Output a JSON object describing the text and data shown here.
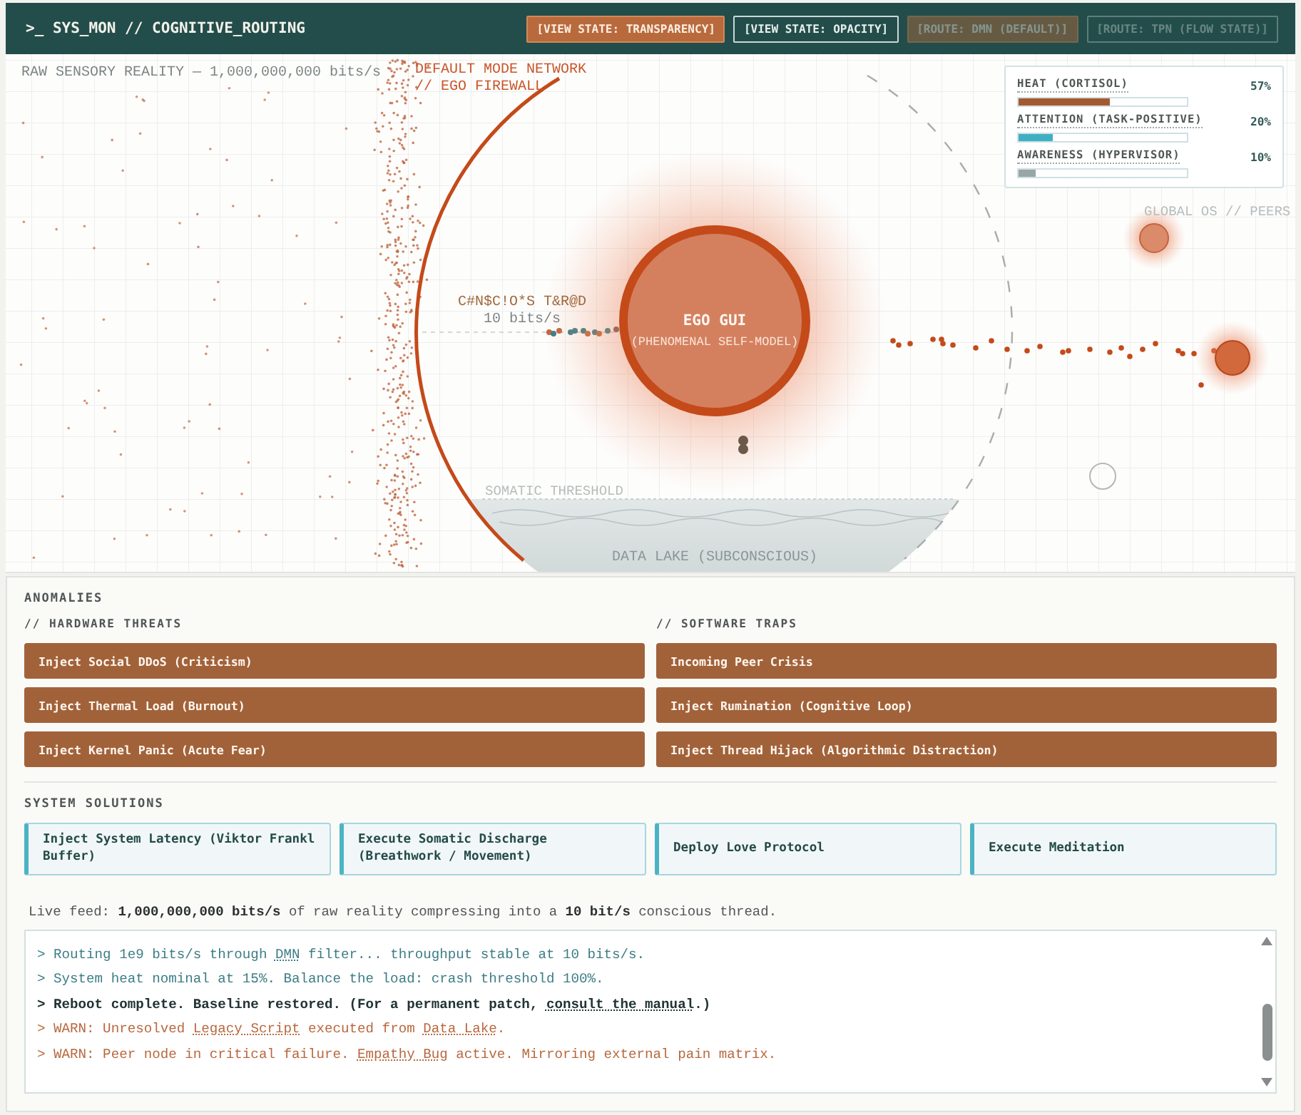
{
  "header": {
    "title": ">_ SYS_MON // COGNITIVE_ROUTING",
    "buttons": [
      {
        "label": "[VIEW STATE: TRANSPARENCY]",
        "selected": true,
        "disabled": false
      },
      {
        "label": "[VIEW STATE: OPACITY]",
        "selected": false,
        "disabled": false
      },
      {
        "label": "[ROUTE: DMN (DEFAULT)]",
        "selected": true,
        "disabled": true
      },
      {
        "label": "[ROUTE: TPN (FLOW STATE)]",
        "selected": false,
        "disabled": true
      }
    ]
  },
  "canvas": {
    "input_label": "RAW SENSORY REALITY — 1,000,000,000 bits/s",
    "firewall_label": [
      "DEFAULT MODE NETWORK",
      "// EGO FIREWALL"
    ],
    "thread_label": "C#N$C!O*S T&R@D",
    "thread_rate": "10 bits/s",
    "ego_title": "EGO GUI",
    "ego_subtitle": "(PHENOMENAL SELF-MODEL)",
    "peers_label": "GLOBAL OS // PEERS",
    "threshold_label": "SOMATIC THRESHOLD",
    "lake_label": "DATA LAKE (SUBCONSCIOUS)"
  },
  "meters": [
    {
      "label": "HEAT (CORTISOL)",
      "reading": "57%",
      "level": 0.54,
      "color": "#a45a30"
    },
    {
      "label": "ATTENTION (TASK-POSITIVE)",
      "reading": "20%",
      "level": 0.2,
      "color": "#3fb0c4"
    },
    {
      "label": "AWARENESS (HYPERVISOR)",
      "reading": "10%",
      "level": 0.1,
      "color": "#98a6a6"
    }
  ],
  "anomalies": {
    "title": "ANOMALIES",
    "groups": [
      {
        "title": "// HARDWARE THREATS",
        "buttons": [
          "Inject Social DDoS (Criticism)",
          "Inject Thermal Load (Burnout)",
          "Inject Kernel Panic (Acute Fear)"
        ]
      },
      {
        "title": "// SOFTWARE TRAPS",
        "buttons": [
          "Incoming Peer Crisis",
          "Inject Rumination (Cognitive Loop)",
          "Inject Thread Hijack (Algorithmic Distraction)"
        ]
      }
    ]
  },
  "solutions": {
    "title": "SYSTEM SOLUTIONS",
    "buttons": [
      "Inject System Latency (Viktor Frankl Buffer)",
      "Execute Somatic Discharge (Breathwork / Movement)",
      "Deploy Love Protocol",
      "Execute Meditation"
    ]
  },
  "feed": "Live feed: **1,000,000,000 bits/s** of raw reality compressing into a **10 bit/s** conscious thread.",
  "log": [
    {
      "kind": "info",
      "segments": [
        {
          "text": "> Routing 1e9 bits/s through ",
          "link": false
        },
        {
          "text": "DMN",
          "link": true
        },
        {
          "text": " filter... throughput stable at 10 bits/s.",
          "link": false
        }
      ]
    },
    {
      "kind": "info",
      "segments": [
        {
          "text": "> System heat nominal at 15%. Balance the load: crash threshold 100%.",
          "link": false
        }
      ]
    },
    {
      "kind": "bold",
      "segments": [
        {
          "text": "> Reboot complete. Baseline restored. (For a permanent patch, ",
          "link": false
        },
        {
          "text": "consult the manual",
          "link": true
        },
        {
          "text": ".)",
          "link": false
        }
      ]
    },
    {
      "kind": "warn",
      "segments": [
        {
          "text": "> WARN: Unresolved ",
          "link": false
        },
        {
          "text": "Legacy Script",
          "link": true
        },
        {
          "text": " executed from ",
          "link": false
        },
        {
          "text": "Data Lake",
          "link": true
        },
        {
          "text": ".",
          "link": false
        }
      ]
    },
    {
      "kind": "warn",
      "segments": [
        {
          "text": "> WARN: Peer node in critical failure. ",
          "link": false
        },
        {
          "text": "Empathy Bug",
          "link": true
        },
        {
          "text": " active. Mirroring external pain matrix.",
          "link": false
        }
      ]
    }
  ]
}
